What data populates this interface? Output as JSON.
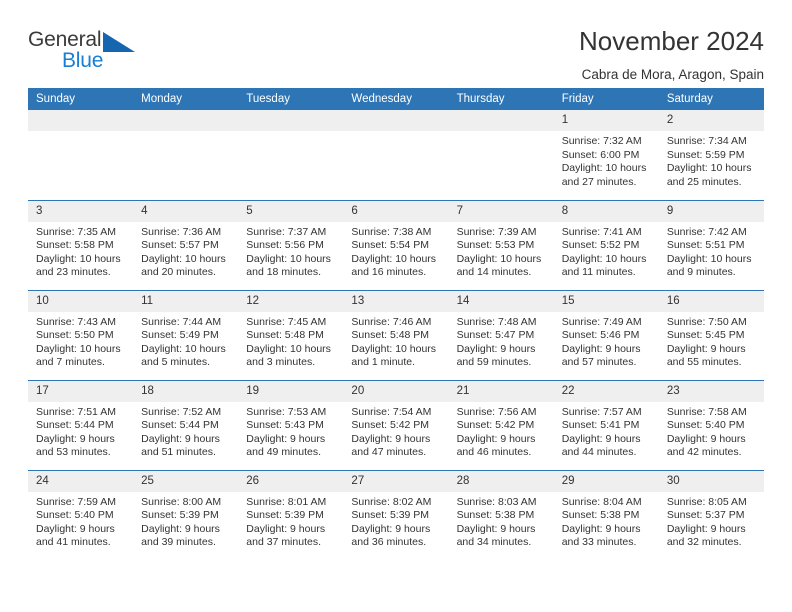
{
  "brand": {
    "word_one": "General",
    "word_two": "Blue",
    "triangle_color": "#1565b0",
    "blue_text_color": "#1a7fd4"
  },
  "header": {
    "title": "November 2024",
    "location": "Cabra de Mora, Aragon, Spain"
  },
  "theme": {
    "header_row_bg": "#2e75b6",
    "header_row_text": "#ffffff",
    "daynum_bg": "#efefef",
    "cell_bg": "#ffffff",
    "row_border": "#2e75b6",
    "body_text": "#333333"
  },
  "calendar": {
    "weekday_headers": [
      "Sunday",
      "Monday",
      "Tuesday",
      "Wednesday",
      "Thursday",
      "Friday",
      "Saturday"
    ],
    "labels": {
      "sunrise_prefix": "Sunrise:",
      "sunset_prefix": "Sunset:",
      "daylight_prefix": "Daylight:"
    },
    "weeks": [
      [
        {
          "day": "",
          "empty": true
        },
        {
          "day": "",
          "empty": true
        },
        {
          "day": "",
          "empty": true
        },
        {
          "day": "",
          "empty": true
        },
        {
          "day": "",
          "empty": true
        },
        {
          "day": "1",
          "sunrise": "Sunrise: 7:32 AM",
          "sunset": "Sunset: 6:00 PM",
          "daylight": "Daylight: 10 hours and 27 minutes."
        },
        {
          "day": "2",
          "sunrise": "Sunrise: 7:34 AM",
          "sunset": "Sunset: 5:59 PM",
          "daylight": "Daylight: 10 hours and 25 minutes."
        }
      ],
      [
        {
          "day": "3",
          "sunrise": "Sunrise: 7:35 AM",
          "sunset": "Sunset: 5:58 PM",
          "daylight": "Daylight: 10 hours and 23 minutes."
        },
        {
          "day": "4",
          "sunrise": "Sunrise: 7:36 AM",
          "sunset": "Sunset: 5:57 PM",
          "daylight": "Daylight: 10 hours and 20 minutes."
        },
        {
          "day": "5",
          "sunrise": "Sunrise: 7:37 AM",
          "sunset": "Sunset: 5:56 PM",
          "daylight": "Daylight: 10 hours and 18 minutes."
        },
        {
          "day": "6",
          "sunrise": "Sunrise: 7:38 AM",
          "sunset": "Sunset: 5:54 PM",
          "daylight": "Daylight: 10 hours and 16 minutes."
        },
        {
          "day": "7",
          "sunrise": "Sunrise: 7:39 AM",
          "sunset": "Sunset: 5:53 PM",
          "daylight": "Daylight: 10 hours and 14 minutes."
        },
        {
          "day": "8",
          "sunrise": "Sunrise: 7:41 AM",
          "sunset": "Sunset: 5:52 PM",
          "daylight": "Daylight: 10 hours and 11 minutes."
        },
        {
          "day": "9",
          "sunrise": "Sunrise: 7:42 AM",
          "sunset": "Sunset: 5:51 PM",
          "daylight": "Daylight: 10 hours and 9 minutes."
        }
      ],
      [
        {
          "day": "10",
          "sunrise": "Sunrise: 7:43 AM",
          "sunset": "Sunset: 5:50 PM",
          "daylight": "Daylight: 10 hours and 7 minutes."
        },
        {
          "day": "11",
          "sunrise": "Sunrise: 7:44 AM",
          "sunset": "Sunset: 5:49 PM",
          "daylight": "Daylight: 10 hours and 5 minutes."
        },
        {
          "day": "12",
          "sunrise": "Sunrise: 7:45 AM",
          "sunset": "Sunset: 5:48 PM",
          "daylight": "Daylight: 10 hours and 3 minutes."
        },
        {
          "day": "13",
          "sunrise": "Sunrise: 7:46 AM",
          "sunset": "Sunset: 5:48 PM",
          "daylight": "Daylight: 10 hours and 1 minute."
        },
        {
          "day": "14",
          "sunrise": "Sunrise: 7:48 AM",
          "sunset": "Sunset: 5:47 PM",
          "daylight": "Daylight: 9 hours and 59 minutes."
        },
        {
          "day": "15",
          "sunrise": "Sunrise: 7:49 AM",
          "sunset": "Sunset: 5:46 PM",
          "daylight": "Daylight: 9 hours and 57 minutes."
        },
        {
          "day": "16",
          "sunrise": "Sunrise: 7:50 AM",
          "sunset": "Sunset: 5:45 PM",
          "daylight": "Daylight: 9 hours and 55 minutes."
        }
      ],
      [
        {
          "day": "17",
          "sunrise": "Sunrise: 7:51 AM",
          "sunset": "Sunset: 5:44 PM",
          "daylight": "Daylight: 9 hours and 53 minutes."
        },
        {
          "day": "18",
          "sunrise": "Sunrise: 7:52 AM",
          "sunset": "Sunset: 5:44 PM",
          "daylight": "Daylight: 9 hours and 51 minutes."
        },
        {
          "day": "19",
          "sunrise": "Sunrise: 7:53 AM",
          "sunset": "Sunset: 5:43 PM",
          "daylight": "Daylight: 9 hours and 49 minutes."
        },
        {
          "day": "20",
          "sunrise": "Sunrise: 7:54 AM",
          "sunset": "Sunset: 5:42 PM",
          "daylight": "Daylight: 9 hours and 47 minutes."
        },
        {
          "day": "21",
          "sunrise": "Sunrise: 7:56 AM",
          "sunset": "Sunset: 5:42 PM",
          "daylight": "Daylight: 9 hours and 46 minutes."
        },
        {
          "day": "22",
          "sunrise": "Sunrise: 7:57 AM",
          "sunset": "Sunset: 5:41 PM",
          "daylight": "Daylight: 9 hours and 44 minutes."
        },
        {
          "day": "23",
          "sunrise": "Sunrise: 7:58 AM",
          "sunset": "Sunset: 5:40 PM",
          "daylight": "Daylight: 9 hours and 42 minutes."
        }
      ],
      [
        {
          "day": "24",
          "sunrise": "Sunrise: 7:59 AM",
          "sunset": "Sunset: 5:40 PM",
          "daylight": "Daylight: 9 hours and 41 minutes."
        },
        {
          "day": "25",
          "sunrise": "Sunrise: 8:00 AM",
          "sunset": "Sunset: 5:39 PM",
          "daylight": "Daylight: 9 hours and 39 minutes."
        },
        {
          "day": "26",
          "sunrise": "Sunrise: 8:01 AM",
          "sunset": "Sunset: 5:39 PM",
          "daylight": "Daylight: 9 hours and 37 minutes."
        },
        {
          "day": "27",
          "sunrise": "Sunrise: 8:02 AM",
          "sunset": "Sunset: 5:39 PM",
          "daylight": "Daylight: 9 hours and 36 minutes."
        },
        {
          "day": "28",
          "sunrise": "Sunrise: 8:03 AM",
          "sunset": "Sunset: 5:38 PM",
          "daylight": "Daylight: 9 hours and 34 minutes."
        },
        {
          "day": "29",
          "sunrise": "Sunrise: 8:04 AM",
          "sunset": "Sunset: 5:38 PM",
          "daylight": "Daylight: 9 hours and 33 minutes."
        },
        {
          "day": "30",
          "sunrise": "Sunrise: 8:05 AM",
          "sunset": "Sunset: 5:37 PM",
          "daylight": "Daylight: 9 hours and 32 minutes."
        }
      ]
    ]
  }
}
